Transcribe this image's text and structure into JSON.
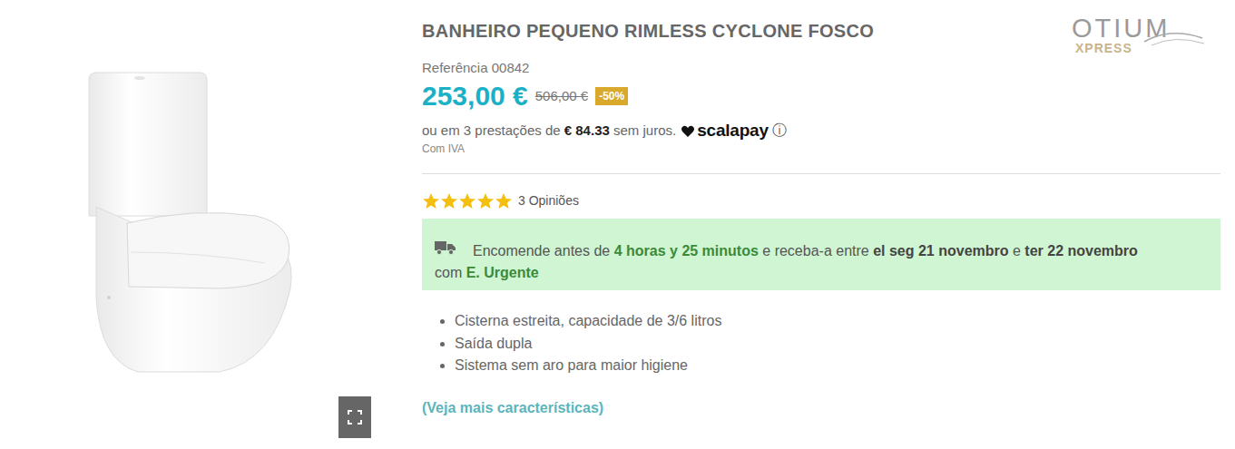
{
  "product": {
    "title": "BANHEIRO PEQUENO RIMLESS CYCLONE FOSCO",
    "reference": "Referência 00842",
    "price": "253,00 €",
    "old_price": "506,00 €",
    "discount": "-50%",
    "installments": {
      "prefix": "ou em 3 prestações de",
      "amount": "€ 84.33",
      "suffix": "sem juros.",
      "provider": "scalapay",
      "info": "ⓘ"
    },
    "tax_note": "Com IVA"
  },
  "logo": {
    "main": "OTIUM",
    "sub": "XPRESS"
  },
  "rating": {
    "stars": 5,
    "count": "3 Opiniões"
  },
  "delivery": {
    "lines": [
      [
        {
          "text": "Encomende antes de ",
          "kind": "plain"
        },
        {
          "text": "4 horas y 25 minutos",
          "kind": "highlight"
        },
        {
          "text": " e receba-a entre ",
          "kind": "plain"
        },
        {
          "text": "el seg 21 novembro",
          "kind": "bold"
        },
        {
          "text": " e ",
          "kind": "plain"
        },
        {
          "text": "ter 22 novembro",
          "kind": "bold"
        }
      ],
      [
        {
          "text": "com ",
          "kind": "plain"
        },
        {
          "text": "E. Urgente",
          "kind": "highlight"
        }
      ]
    ]
  },
  "features": [
    "Cisterna estreita, capacidade de 3/6 litros",
    "Saída dupla",
    "Sistema sem aro para maior higiene"
  ],
  "more_link": "(Veja mais características)"
}
